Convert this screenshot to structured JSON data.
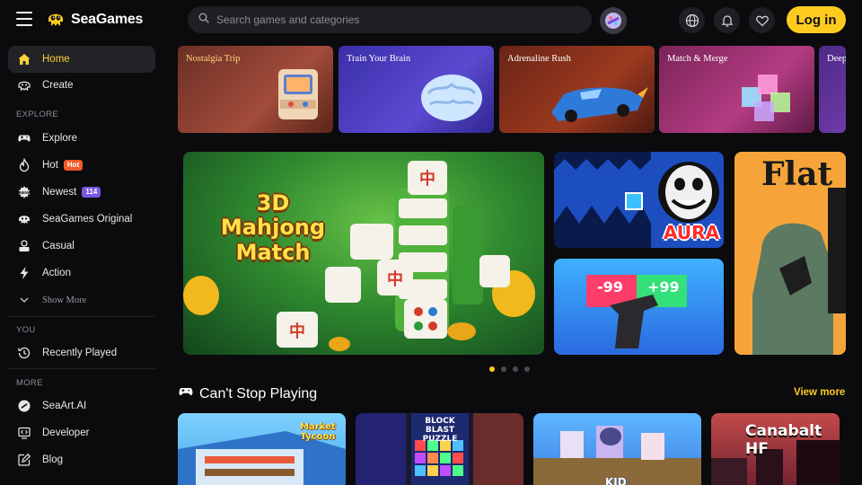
{
  "header": {
    "logo_text": "SeaGames",
    "search_placeholder": "Search games and categories",
    "login_label": "Log in"
  },
  "sidebar": {
    "items": [
      {
        "label": "Home",
        "icon": "home-icon"
      },
      {
        "label": "Create",
        "icon": "create-icon"
      }
    ],
    "explore_title": "EXPLORE",
    "explore_items": [
      {
        "label": "Explore",
        "icon": "gamepad-icon"
      },
      {
        "label": "Hot",
        "icon": "flame-icon",
        "badge": "Hot"
      },
      {
        "label": "Newest",
        "icon": "new-icon",
        "badge": "114"
      },
      {
        "label": "SeaGames Original",
        "icon": "original-icon"
      },
      {
        "label": "Casual",
        "icon": "casual-icon"
      },
      {
        "label": "Action",
        "icon": "lightning-icon"
      }
    ],
    "show_more": "Show More",
    "you_title": "YOU",
    "you_items": [
      {
        "label": "Recently Played",
        "icon": "history-icon"
      }
    ],
    "more_title": "MORE",
    "more_items": [
      {
        "label": "SeaArt.AI",
        "icon": "seaart-icon"
      },
      {
        "label": "Developer",
        "icon": "code-icon"
      },
      {
        "label": "Blog",
        "icon": "edit-icon"
      }
    ]
  },
  "categories": [
    {
      "label": "Nostalgia Trip",
      "color": "#8a3f2e"
    },
    {
      "label": "Train Your Brain",
      "color": "#4b3a9e"
    },
    {
      "label": "Adrenaline Rush",
      "color": "#7a2a1c"
    },
    {
      "label": "Match & Merge",
      "color": "#8a2d63"
    },
    {
      "label": "Deep",
      "color": "#5b2d8a"
    }
  ],
  "hero": {
    "title_line1": "3D",
    "title_line2": "Mahjong",
    "title_line3": "Match"
  },
  "tiles": {
    "aura_text": "AURA",
    "gun_left": "-99",
    "gun_right": "+99",
    "flat_text": "Flat"
  },
  "carousel": {
    "count": 4,
    "active": 0
  },
  "section": {
    "title": "Can't Stop Playing",
    "view_more": "View more"
  },
  "cards": [
    {
      "text": "Market Tycoon"
    },
    {
      "text": "BLOCK BLAST PUZZLE"
    },
    {
      "text": "KID"
    },
    {
      "text": "Canabalt HF"
    }
  ],
  "colors": {
    "accent": "#ffcb1f",
    "background": "#0b0b0d",
    "active_nav": "#232327"
  }
}
